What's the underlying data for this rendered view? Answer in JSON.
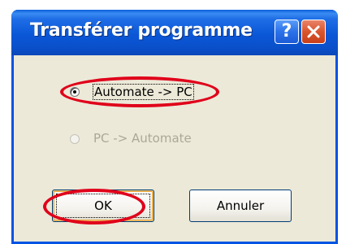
{
  "window": {
    "title": "Transférer programme",
    "help_label": "?",
    "close_icon": "close-icon",
    "colors": {
      "title_bar": "#0b57d7",
      "close_button": "#d9552e",
      "dialog_bg": "#ece9d8"
    }
  },
  "options": [
    {
      "label": "Automate -> PC",
      "selected": true,
      "enabled": true
    },
    {
      "label": "PC -> Automate",
      "selected": false,
      "enabled": false
    }
  ],
  "buttons": {
    "ok_label": "OK",
    "cancel_label": "Annuler"
  },
  "annotations": {
    "color": "#e0001a",
    "highlights": [
      "option-automate-pc",
      "ok-button"
    ]
  }
}
